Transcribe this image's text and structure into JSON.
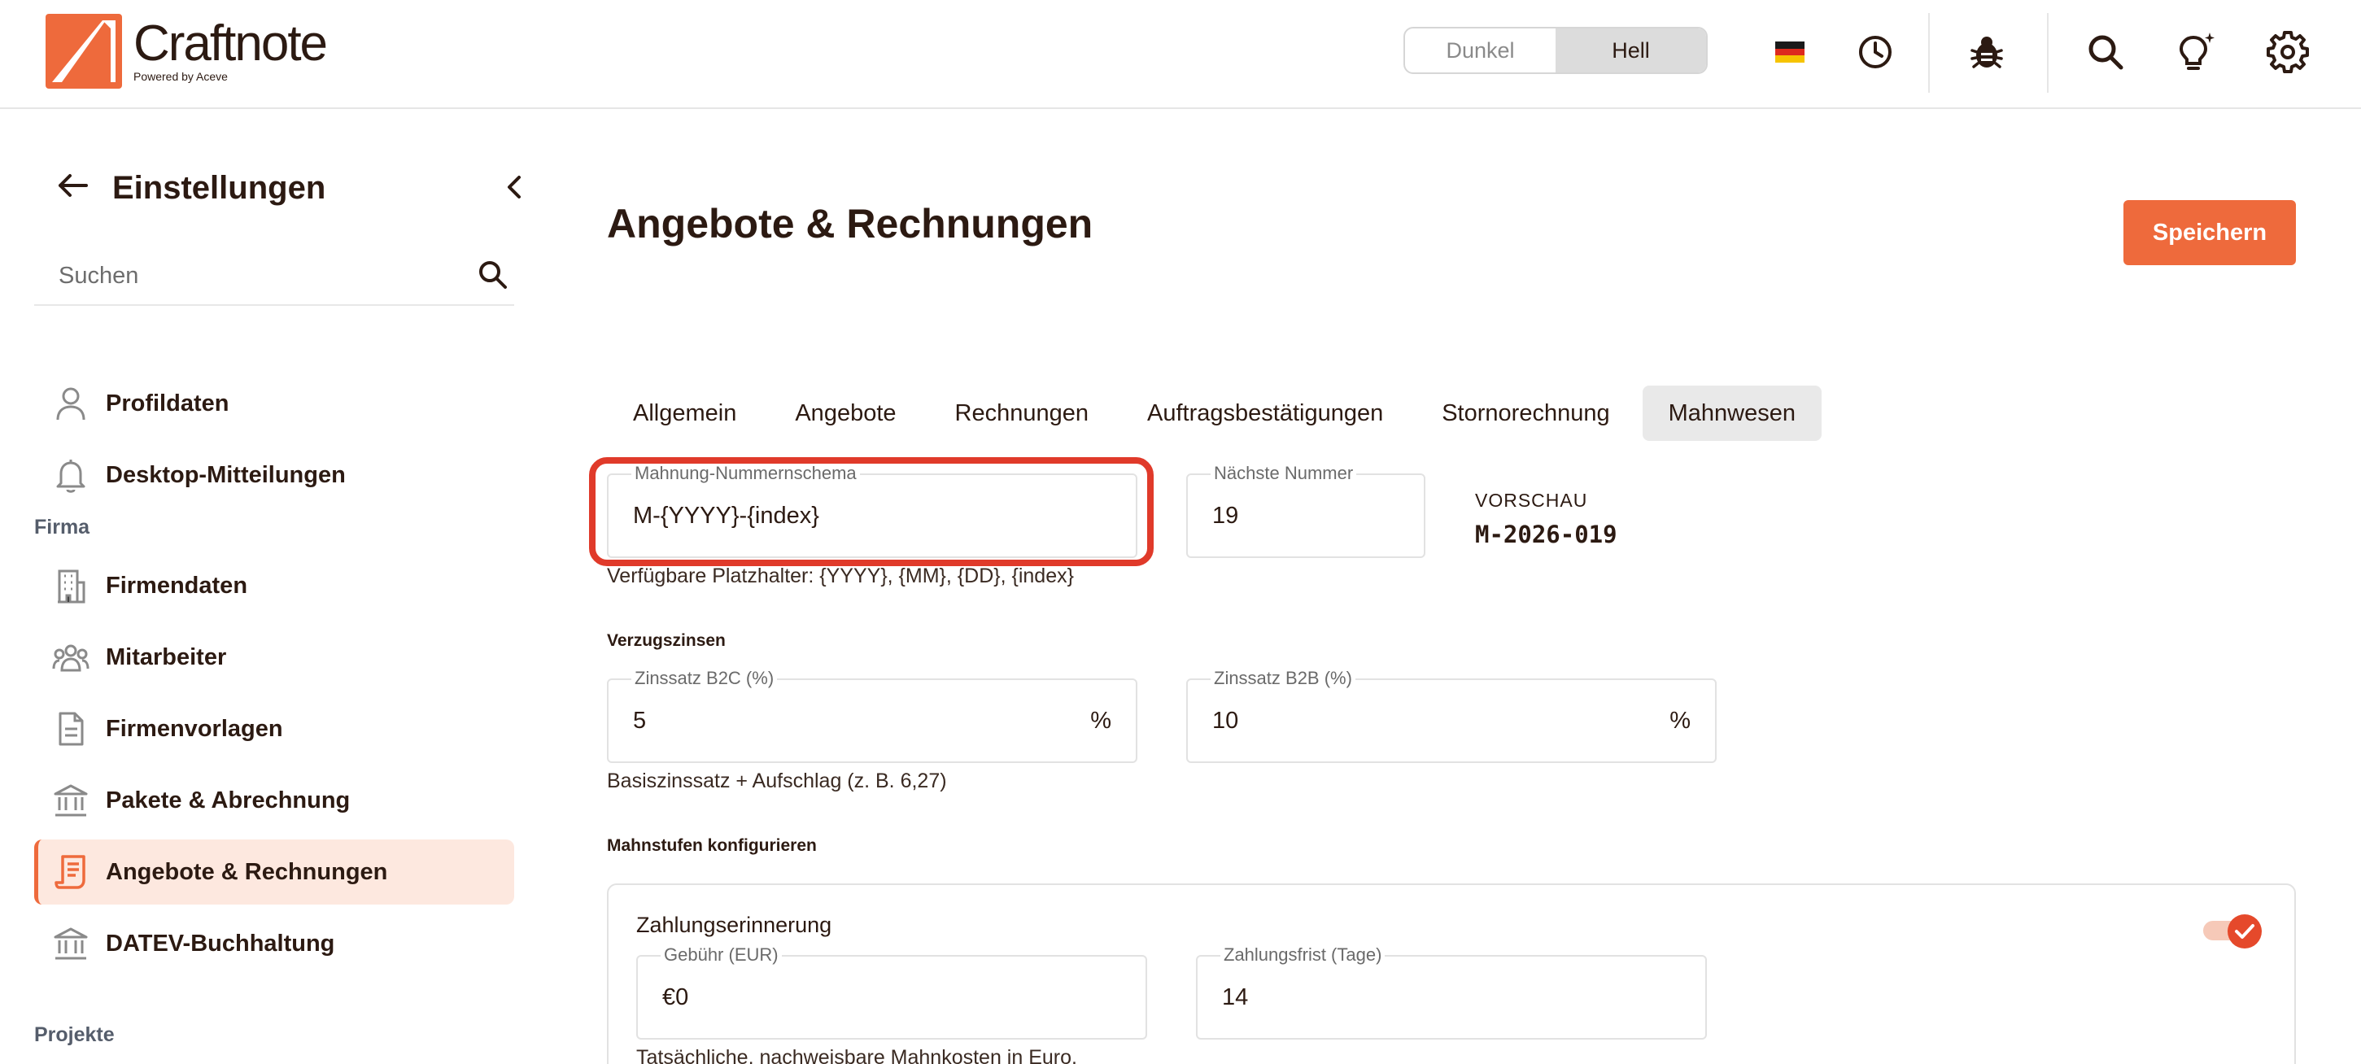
{
  "header": {
    "logo_name": "Craftnote",
    "logo_sub": "Powered by Aceve",
    "theme_dark": "Dunkel",
    "theme_light": "Hell",
    "active_theme": "Hell",
    "icons": [
      "flag-germany-icon",
      "clock-icon",
      "bug-icon",
      "search-icon",
      "lightbulb-icon",
      "gear-icon"
    ]
  },
  "sidebar": {
    "title": "Einstellungen",
    "search_placeholder": "Suchen",
    "items": [
      {
        "label": "Profildaten",
        "icon": "person-icon"
      },
      {
        "label": "Desktop-Mitteilungen",
        "icon": "bell-icon"
      }
    ],
    "section_firma": "Firma",
    "firma_items": [
      {
        "label": "Firmendaten",
        "icon": "building-icon"
      },
      {
        "label": "Mitarbeiter",
        "icon": "users-icon"
      },
      {
        "label": "Firmenvorlagen",
        "icon": "document-icon"
      },
      {
        "label": "Pakete & Abrechnung",
        "icon": "bank-icon"
      },
      {
        "label": "Angebote & Rechnungen",
        "icon": "invoice-icon",
        "active": true
      },
      {
        "label": "DATEV-Buchhaltung",
        "icon": "bank-icon"
      }
    ],
    "section_projekte": "Projekte"
  },
  "main": {
    "title": "Angebote & Rechnungen",
    "save_label": "Speichern",
    "tabs": [
      "Allgemein",
      "Angebote",
      "Rechnungen",
      "Auftragsbestätigungen",
      "Stornorechnung",
      "Mahnwesen"
    ],
    "active_tab": "Mahnwesen",
    "number_scheme": {
      "label": "Mahnung-Nummernschema",
      "value": "M-{YYYY}-{index}",
      "hint": "Verfügbare Platzhalter: {YYYY}, {MM}, {DD}, {index}"
    },
    "next_number": {
      "label": "Nächste Nummer",
      "value": "19"
    },
    "preview": {
      "label": "VORSCHAU",
      "value": "M-2026-019"
    },
    "interest": {
      "heading": "Verzugszinsen",
      "b2c_label": "Zinssatz B2C (%)",
      "b2c_value": "5",
      "b2b_label": "Zinssatz B2B (%)",
      "b2b_value": "10",
      "suffix": "%",
      "hint": "Basiszinssatz + Aufschlag (z. B. 6,27)"
    },
    "levels": {
      "heading": "Mahnstufen konfigurieren",
      "card_title": "Zahlungserinnerung",
      "enabled": true,
      "fee_label": "Gebühr (EUR)",
      "fee_value": "€0",
      "deadline_label": "Zahlungsfrist (Tage)",
      "deadline_value": "14",
      "hint": "Tatsächliche, nachweisbare Mahnkosten in Euro."
    }
  },
  "colors": {
    "accent": "#ee6a3c",
    "highlight": "#e03a2a",
    "active_nav_bg": "#fde8df"
  }
}
